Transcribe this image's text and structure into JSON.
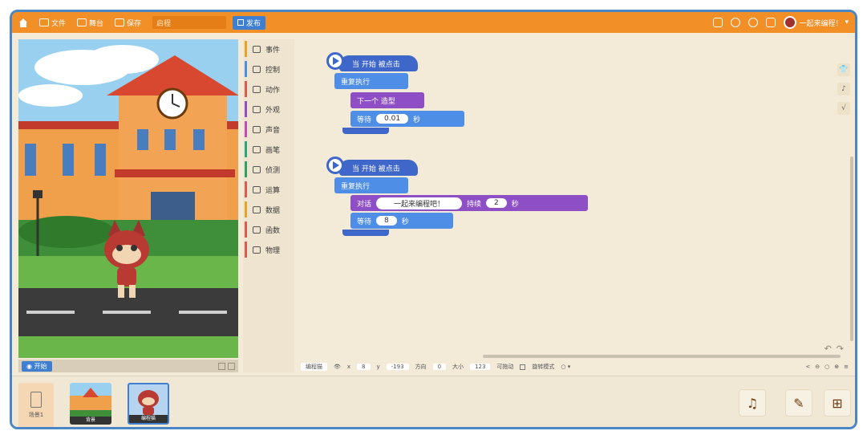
{
  "topbar": {
    "file": "文件",
    "stage": "舞台",
    "save": "保存",
    "project_name": "启程",
    "publish": "发布",
    "username": "一起来编程！"
  },
  "stage_bar": {
    "start": "开始"
  },
  "categories": [
    {
      "label": "事件",
      "color": "#e8a225",
      "icon": "event-icon"
    },
    {
      "label": "控制",
      "color": "#4f8ee6",
      "icon": "control-icon"
    },
    {
      "label": "动作",
      "color": "#e05a4b",
      "icon": "motion-icon"
    },
    {
      "label": "外观",
      "color": "#8e4ec5",
      "icon": "looks-icon"
    },
    {
      "label": "声音",
      "color": "#c44bb6",
      "icon": "sound-icon"
    },
    {
      "label": "画笔",
      "color": "#2aa77d",
      "icon": "pen-icon"
    },
    {
      "label": "侦测",
      "color": "#2fa05e",
      "icon": "sensing-icon"
    },
    {
      "label": "运算",
      "color": "#e05a4b",
      "icon": "operator-icon"
    },
    {
      "label": "数据",
      "color": "#e8a225",
      "icon": "data-icon"
    },
    {
      "label": "函数",
      "color": "#e05a4b",
      "icon": "function-icon"
    },
    {
      "label": "物理",
      "color": "#e05a4b",
      "icon": "physics-icon"
    }
  ],
  "script1": {
    "hat": "当 开始 被点击",
    "loop": "重复执行",
    "next_costume": "下一个 造型",
    "wait_label": "等待",
    "wait_value": "0.01",
    "wait_unit": "秒"
  },
  "script2": {
    "hat": "当 开始 被点击",
    "loop": "重复执行",
    "say_label": "对话",
    "say_text": "一起来编程吧！",
    "duration_label": "持续",
    "duration_value": "2",
    "duration_unit": "秒",
    "wait_label": "等待",
    "wait_value": "8",
    "wait_unit": "秒"
  },
  "status": {
    "sprite": "编程猫",
    "x_label": "x",
    "x_value": "8",
    "y_label": "y",
    "y_value": "-193",
    "direction_label": "方向",
    "direction_value": "0",
    "size_label": "大小",
    "size_value": "123",
    "draggable": "可拖动",
    "rotation": "旋转模式"
  },
  "bottom": {
    "scene": "场景1",
    "backdrop_label": "背景",
    "sprite_label": "编程猫"
  }
}
